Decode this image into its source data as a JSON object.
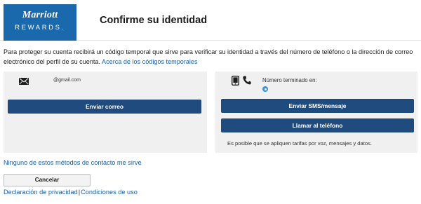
{
  "header": {
    "logo": {
      "line1": "Marriott",
      "line2": "REWARDS."
    },
    "title": "Confirme su identidad"
  },
  "intro": {
    "text": "Para proteger su cuenta recibirá un código temporal que sirve para verificar su identidad a través del número de teléfono o la dirección de correo electrónico del perfil de su cuenta.",
    "link": "Acerca de los códigos temporales"
  },
  "email_option": {
    "icon": "envelope-icon",
    "email": "@gmail.com",
    "button": "Enviar correo"
  },
  "phone_option": {
    "icons": [
      "mobile-phone-icon",
      "handset-icon"
    ],
    "label": "Número terminado en:",
    "sms_button": "Enviar SMS/mensaje",
    "call_button": "Llamar al teléfono",
    "fees_note": "Es posible que se apliquen tarifas por voz, mensajes y datos.",
    "radio_color": "#3b8fe6"
  },
  "none_link": "Ninguno de estos métodos de contacto me sirve",
  "cancel_button": "Cancelar",
  "footer": {
    "privacy": "Declaración de privacidad",
    "separator": "|",
    "terms": "Condiciones de uso"
  },
  "colors": {
    "brand": "#1b69ad",
    "button": "#1f4b7e",
    "link": "#1c5fa4",
    "panel": "#f0f0f0"
  }
}
